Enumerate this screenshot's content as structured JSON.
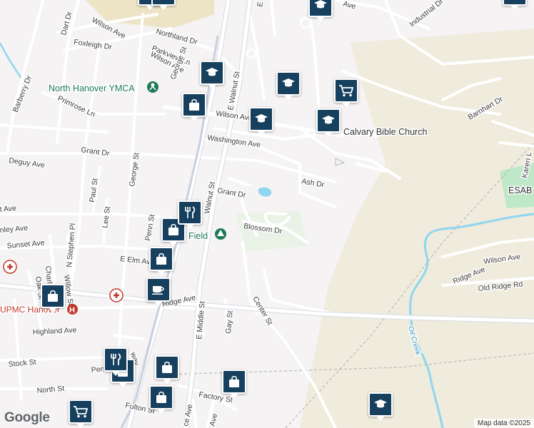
{
  "map": {
    "attribution": "Map data ©2025",
    "logo": "Google",
    "streets": [
      "Wilson Ave",
      "Dart Dr",
      "Foxleigh Dr",
      "Northland Dr",
      "Parkview Ln",
      "Wilson Ave",
      "George St",
      "E Walnut St",
      "Barberry Dr",
      "Primrose Ln",
      "Wilson Ave",
      "Washington Ave",
      "Grant Dr",
      "Deguy Ave",
      "George St",
      "Paul St",
      "Grant Dr",
      "Ash Dr",
      "Walnut St",
      "Penn St",
      "Lee St",
      "Blossom Dr",
      "Sunset Ave",
      "N Stephen Pl",
      "Willow St",
      "E Elm Ave",
      "Charl St",
      "Oak St",
      "Ridge Ave",
      "E Middle St",
      "Gay St",
      "Center St",
      "Highland Ave",
      "Stock St",
      "North St",
      "Fulton St",
      "Factory St",
      "Industrial Dr",
      "Barnhart Dr",
      "Karen L",
      "Wilson Ave",
      "Ridge Ave",
      "Old Ridge Rd",
      "nley Ave",
      "t Ave",
      "way",
      "Penn",
      "ce Ave",
      "Ave",
      "E",
      "Ave"
    ],
    "places": {
      "ymca": "North Hanover YMCA",
      "church": "Calvary Bible Church",
      "hospital": "UPMC Hanover",
      "park": "Field",
      "esab": "ESAB",
      "creek": "Oil Creek"
    },
    "icons": {
      "school": "school-icon",
      "shopping": "shopping-bag-icon",
      "cart": "shopping-cart-icon",
      "restaurant": "restaurant-icon",
      "cafe": "cafe-icon",
      "hospital": "hospital-icon",
      "park": "tree-icon",
      "gym": "ymca-icon"
    },
    "colors": {
      "background": "#f5f3f3",
      "road": "#ffffff",
      "roadEdge": "#d6d9df",
      "arterial": "#cfd6e2",
      "water": "#8fd6f0",
      "marker": "#17405f",
      "park": "#bfe8c8",
      "poiGreen": "#1e7a55",
      "hospitalRed": "#c0392b",
      "sand": "#ede8d4"
    }
  }
}
